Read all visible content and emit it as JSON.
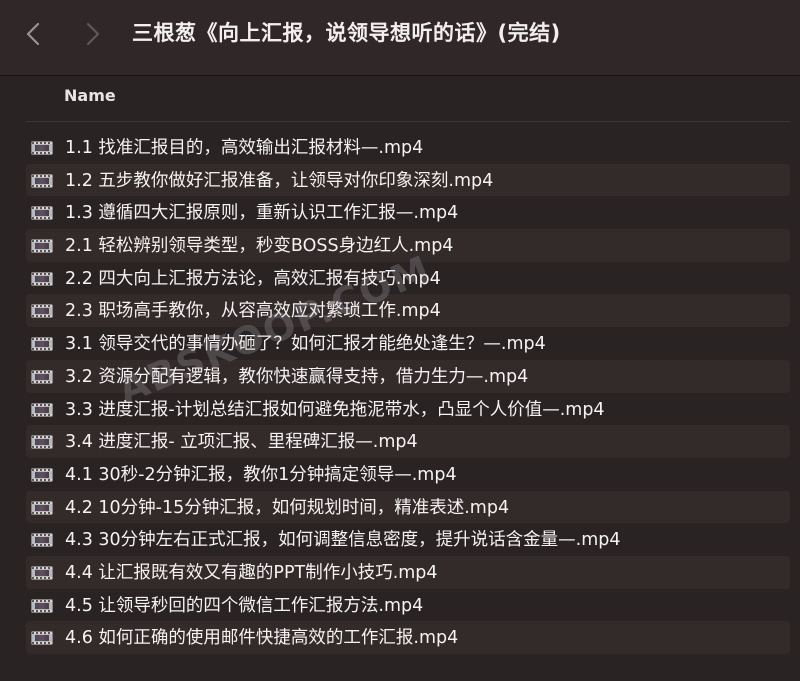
{
  "toolbar": {
    "back_icon": "chevron-left-icon",
    "forward_icon": "chevron-right-icon",
    "title": "三根葱《向上汇报，说领导想听的话》(完结)"
  },
  "columns": {
    "name_header": "Name"
  },
  "file_icon": "video-file-icon",
  "files": [
    "1.1 找准汇报目的，高效输出汇报材料—.mp4",
    "1.2 五步教你做好汇报准备，让领导对你印象深刻.mp4",
    "1.3 遵循四大汇报原则，重新认识工作汇报—.mp4",
    "2.1 轻松辨别领导类型，秒变BOSS身边红人.mp4",
    "2.2 四大向上汇报方法论，高效汇报有技巧.mp4",
    "2.3 职场高手教你，从容高效应对繁琐工作.mp4",
    "3.1 领导交代的事情办砸了？如何汇报才能绝处逢生？—.mp4",
    "3.2 资源分配有逻辑，教你快速赢得支持，借力生力—.mp4",
    "3.3 进度汇报-计划总结汇报如何避免拖泥带水，凸显个人价值—.mp4",
    "3.4 进度汇报- 立项汇报、里程碑汇报—.mp4",
    "4.1 30秒-2分钟汇报，教你1分钟搞定领导—.mp4",
    "4.2 10分钟-15分钟汇报，如何规划时间，精准表述.mp4",
    "4.3 30分钟左右正式汇报，如何调整信息密度，提升说话含金量—.mp4",
    "4.4 让汇报既有效又有趣的PPT制作小技巧.mp4",
    "4.5 让领导秒回的四个微信工作汇报方法.mp4",
    "4.6 如何正确的使用邮件快捷高效的工作汇报.mp4"
  ],
  "watermark": "ABSKOOP.COM",
  "colors": {
    "background": "#2a2323",
    "toolbar": "#2f2728",
    "alt_row": "#332a2a",
    "text": "#f5f2f2"
  }
}
